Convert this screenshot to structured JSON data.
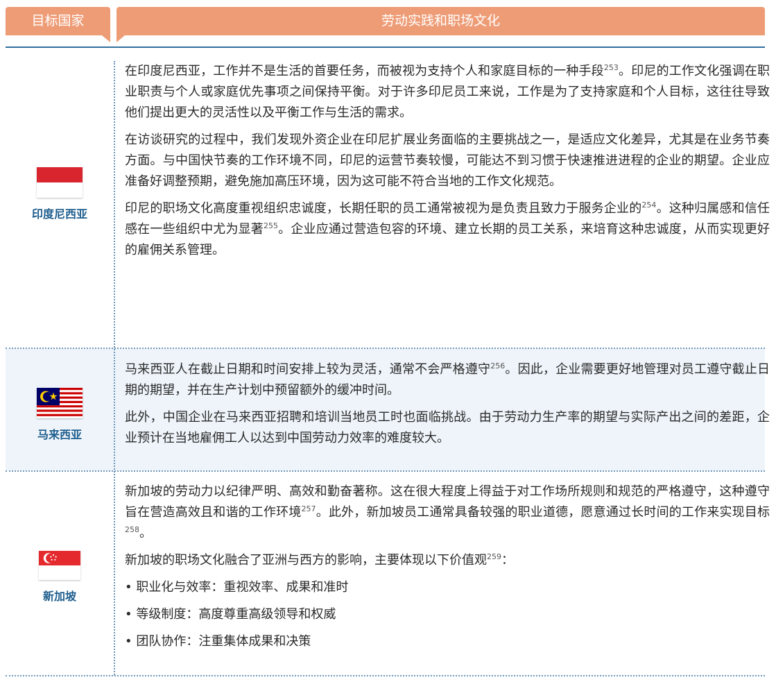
{
  "header": {
    "col_country": "目标国家",
    "col_culture": "劳动实践和职场文化"
  },
  "rows": [
    {
      "country": "印度尼西亚",
      "flag_icon": "indonesia-flag",
      "paragraphs": [
        {
          "parts": [
            {
              "t": "在印度尼西亚，工作并不是生活的首要任务，而被视为支持个人和家庭目标的一种手段"
            },
            {
              "sup": "253"
            },
            {
              "t": "。印尼的工作文化强调在职业职责与个人或家庭优先事项之间保持平衡。对于许多印尼员工来说，工作是为了支持家庭和个人目标，这往往导致他们提出更大的灵活性以及平衡工作与生活的需求。"
            }
          ]
        },
        {
          "parts": [
            {
              "t": "在访谈研究的过程中，我们发现外资企业在印尼扩展业务面临的主要挑战之一，是适应文化差异，尤其是在业务节奏方面。与中国快节奏的工作环境不同，印尼的运营节奏较慢，可能达不到习惯于快速推进进程的企业的期望。企业应准备好调整预期，避免施加高压环境，因为这可能不符合当地的工作文化规范。"
            }
          ]
        },
        {
          "parts": [
            {
              "t": "印尼的职场文化高度重视组织忠诚度，长期任职的员工通常被视为是负责且致力于服务企业的"
            },
            {
              "sup": "254"
            },
            {
              "t": "。这种归属感和信任感在一些组织中尤为显著"
            },
            {
              "sup": "255"
            },
            {
              "t": "。企业应通过营造包容的环境、建立长期的员工关系，来培育这种忠诚度，从而实现更好的雇佣关系管理。"
            }
          ]
        }
      ]
    },
    {
      "country": "马来西亚",
      "flag_icon": "malaysia-flag",
      "paragraphs": [
        {
          "parts": [
            {
              "t": "马来西亚人在截止日期和时间安排上较为灵活，通常不会严格遵守"
            },
            {
              "sup": "256"
            },
            {
              "t": "。因此，企业需要更好地管理对员工遵守截止日期的期望，并在生产计划中预留额外的缓冲时间。"
            }
          ]
        },
        {
          "parts": [
            {
              "t": "此外，中国企业在马来西亚招聘和培训当地员工时也面临挑战。由于劳动力生产率的期望与实际产出之间的差距，企业预计在当地雇佣工人以达到中国劳动力效率的难度较大。"
            }
          ]
        }
      ]
    },
    {
      "country": "新加坡",
      "flag_icon": "singapore-flag",
      "paragraphs": [
        {
          "parts": [
            {
              "t": "新加坡的劳动力以纪律严明、高效和勤奋著称。这在很大程度上得益于对工作场所规则和规范的严格遵守，这种遵守旨在营造高效且和谐的工作环境"
            },
            {
              "sup": "257"
            },
            {
              "t": "。此外，新加坡员工通常具备较强的职业道德，愿意通过长时间的工作来实现目标"
            },
            {
              "sup": "258"
            },
            {
              "t": "。"
            }
          ]
        },
        {
          "parts": [
            {
              "t": "新加坡的职场文化融合了亚洲与西方的影响，主要体现以下价值观"
            },
            {
              "sup": "259"
            },
            {
              "t": "："
            }
          ]
        },
        {
          "parts": [
            {
              "t": "• 职业化与效率：重视效率、成果和准时"
            }
          ]
        },
        {
          "parts": [
            {
              "t": "• 等级制度：高度尊重高级领导和权威"
            }
          ]
        },
        {
          "parts": [
            {
              "t": "• 团队协作：注重集体成果和决策"
            }
          ]
        }
      ]
    }
  ],
  "colors": {
    "header_bg": "#ee9c76",
    "divider": "#2e6f9e",
    "country_name": "#1f5e8e",
    "shaded_row": "#eef4fa"
  }
}
